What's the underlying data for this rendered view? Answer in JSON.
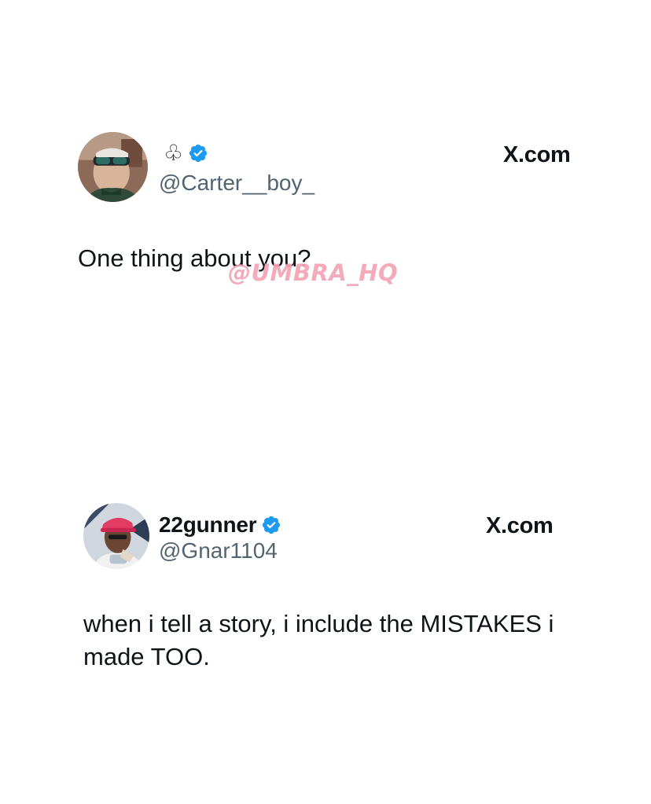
{
  "tweets": [
    {
      "display_name": "",
      "name_symbol": "♧",
      "verified": true,
      "handle": "@Carter__boy_",
      "source": "X.com",
      "text": "One thing about you?",
      "avatar_icon": "avatar-photo-icon"
    },
    {
      "display_name": "22gunner",
      "verified": true,
      "handle": "@Gnar1104",
      "source": "X.com",
      "text": "when i tell a story, i include the MISTAKES i made TOO.",
      "avatar_icon": "avatar-photo-icon"
    }
  ],
  "watermark": "@UMBRA_HQ",
  "colors": {
    "text": "#0f1419",
    "handle": "#536471",
    "verified": "#1d9bf0",
    "watermark": "#f5a3b5",
    "background": "#ffffff"
  }
}
